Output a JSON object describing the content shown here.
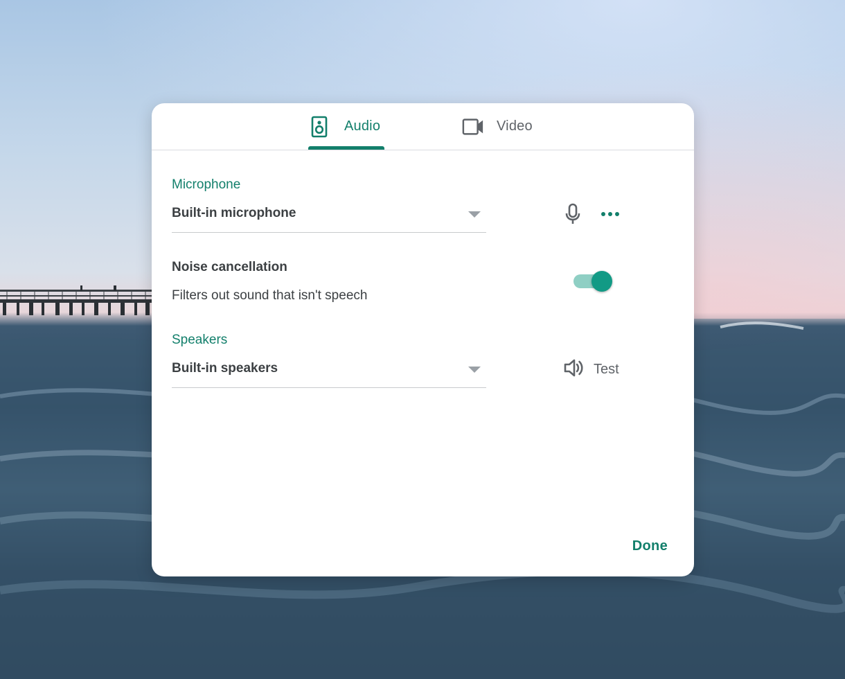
{
  "dialog": {
    "tabs": [
      {
        "label": "Audio",
        "icon": "speaker-icon",
        "selected": true
      },
      {
        "label": "Video",
        "icon": "videocam-icon",
        "selected": false
      }
    ],
    "microphone": {
      "section_label": "Microphone",
      "selected_device": "Built-in microphone",
      "icons": [
        "microphone-icon",
        "more-options-icon"
      ]
    },
    "noise_cancellation": {
      "title": "Noise cancellation",
      "description": "Filters out sound that isn't speech",
      "enabled": true
    },
    "speakers": {
      "section_label": "Speakers",
      "selected_device": "Built-in speakers",
      "test_label": "Test",
      "test_icon": "volume-icon"
    },
    "done_label": "Done"
  },
  "colors": {
    "accent": "#127f6b",
    "toggle_knob": "#129a85",
    "toggle_track": "#8fcfc4",
    "text_primary": "#3c4043",
    "text_secondary": "#5f6368"
  }
}
